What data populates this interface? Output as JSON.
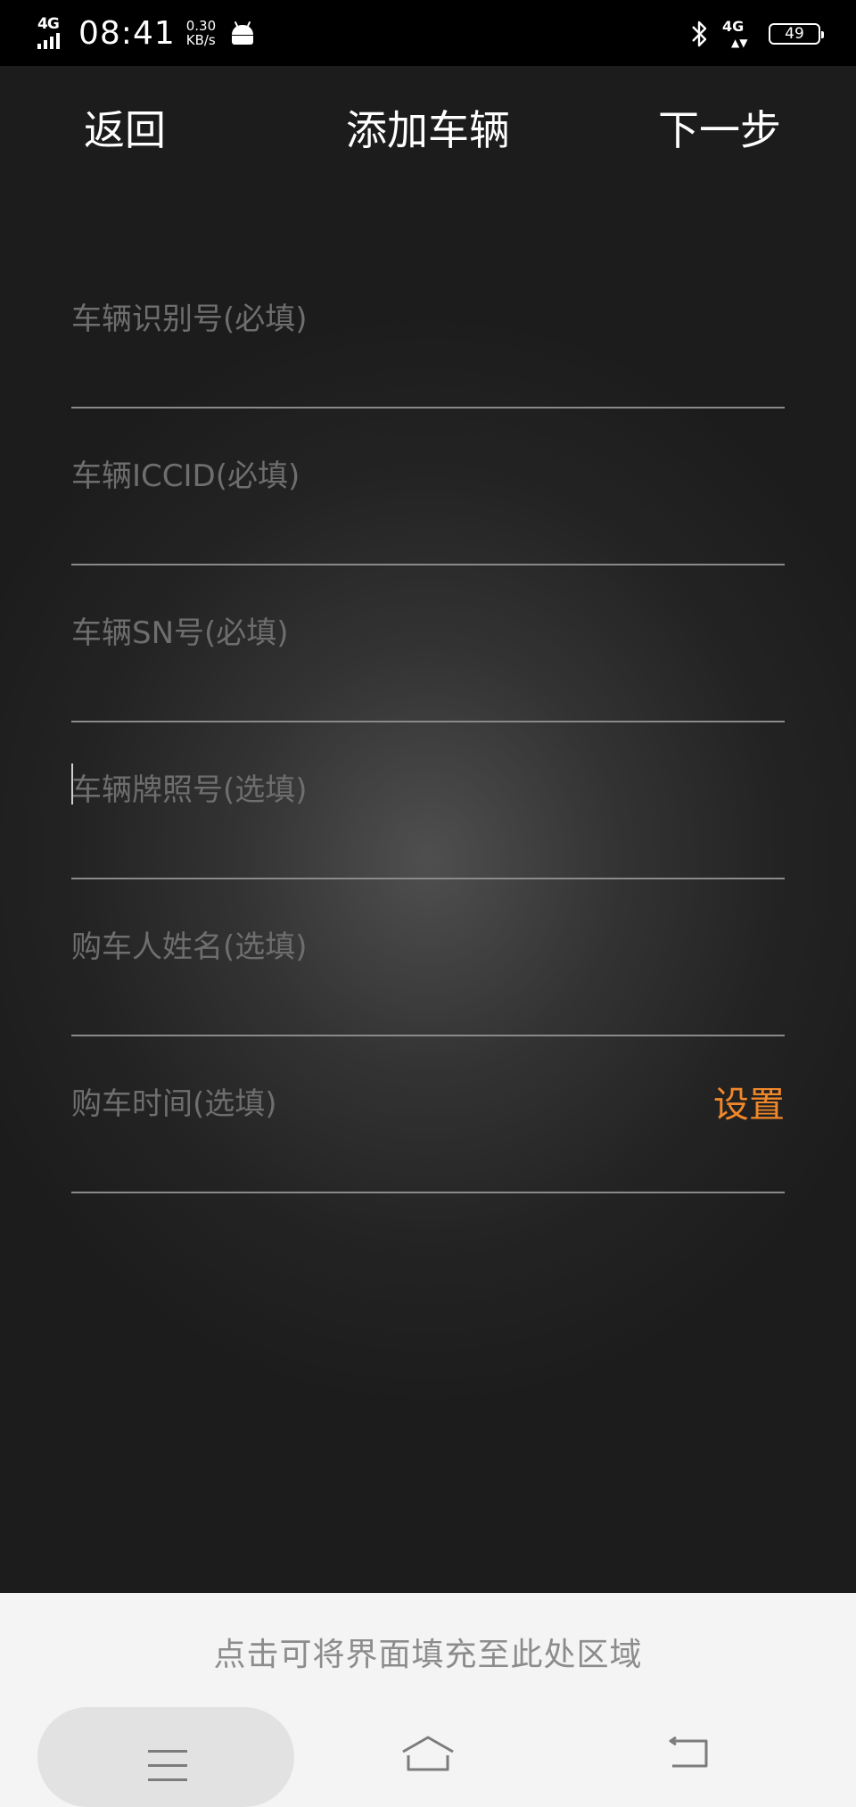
{
  "status_bar": {
    "network_left": "4G",
    "time": "08:41",
    "speed_value": "0.30",
    "speed_unit": "KB/s",
    "network_right": "4G",
    "battery": "49"
  },
  "header": {
    "back_label": "返回",
    "title": "添加车辆",
    "next_label": "下一步"
  },
  "form": {
    "fields": [
      {
        "placeholder": "车辆识别号(必填)",
        "value": ""
      },
      {
        "placeholder": "车辆ICCID(必填)",
        "value": ""
      },
      {
        "placeholder": "车辆SN号(必填)",
        "value": ""
      },
      {
        "placeholder": "车辆牌照号(选填)",
        "value": ""
      },
      {
        "placeholder": "购车人姓名(选填)",
        "value": ""
      },
      {
        "placeholder": "购车时间(选填)",
        "value": "",
        "action_label": "设置"
      }
    ]
  },
  "bottom_panel": {
    "hint": "点击可将界面填充至此处区域"
  },
  "colors": {
    "accent": "#f0882a",
    "placeholder": "#6e6e6e",
    "divider": "#8a8a8a"
  },
  "icons": [
    "signal-icon",
    "android-icon",
    "bluetooth-icon",
    "battery-icon",
    "menu-icon",
    "home-icon",
    "back-icon"
  ]
}
